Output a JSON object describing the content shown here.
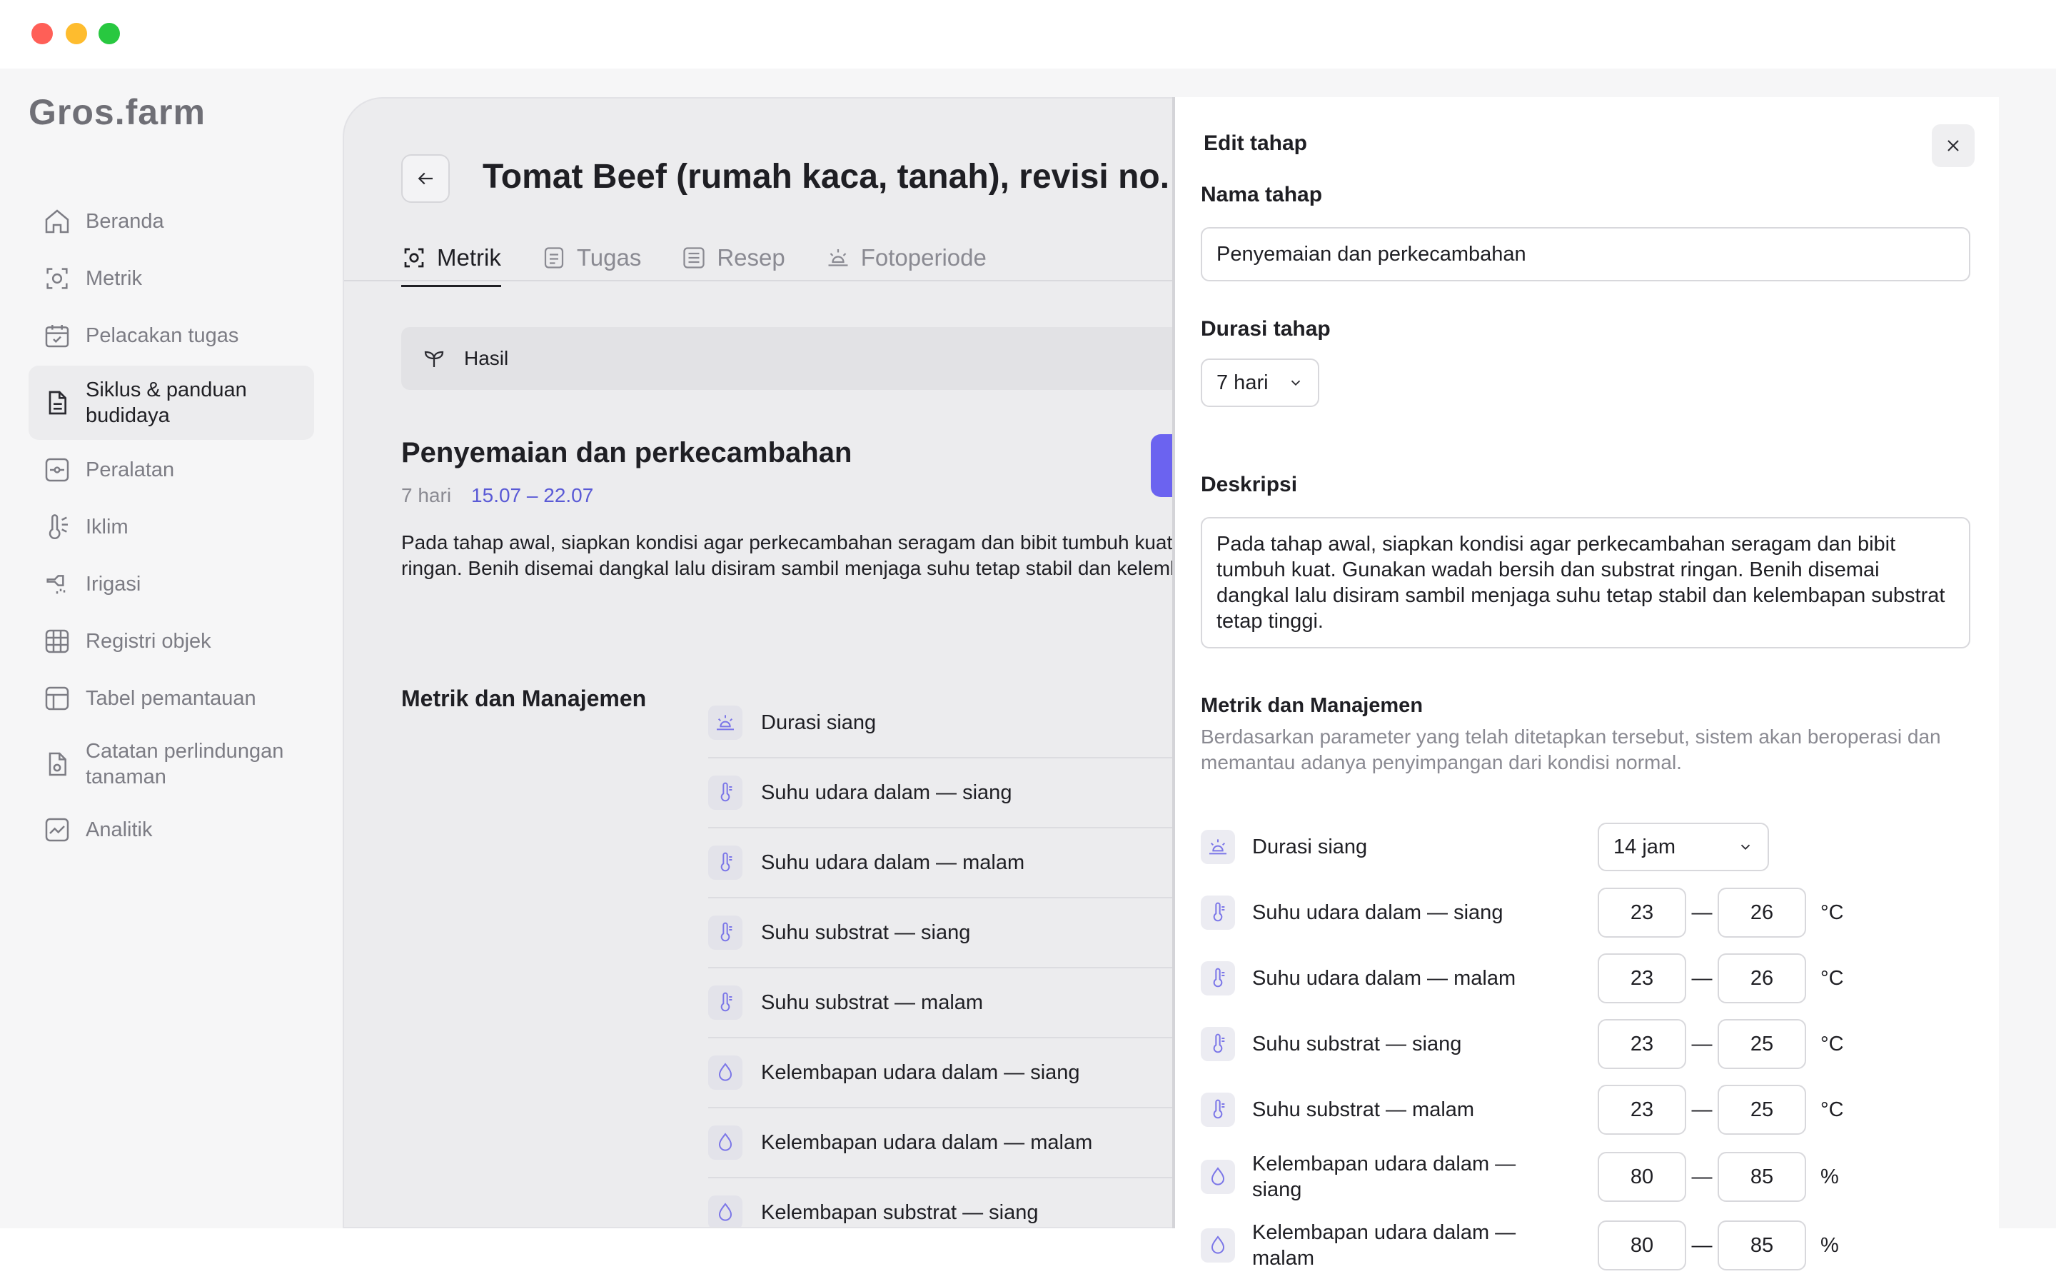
{
  "sidebar": {
    "logo": "Gros.farm",
    "items": [
      {
        "label": "Beranda",
        "icon": "home-icon"
      },
      {
        "label": "Metrik",
        "icon": "metric-icon"
      },
      {
        "label": "Pelacakan tugas",
        "icon": "calendar-check-icon"
      },
      {
        "label": "Siklus & panduan budidaya",
        "icon": "document-icon",
        "active": true
      },
      {
        "label": "Peralatan",
        "icon": "equipment-icon"
      },
      {
        "label": "Iklim",
        "icon": "climate-icon"
      },
      {
        "label": "Irigasi",
        "icon": "irrigation-icon"
      },
      {
        "label": "Registri objek",
        "icon": "grid-icon"
      },
      {
        "label": "Tabel pemantauan",
        "icon": "table-icon"
      },
      {
        "label": "Catatan perlindungan tanaman",
        "icon": "protection-note-icon"
      },
      {
        "label": "Analitik",
        "icon": "analytics-icon"
      }
    ]
  },
  "main": {
    "title": "Tomat Beef (rumah kaca, tanah), revisi no.",
    "tabs": [
      {
        "label": "Metrik",
        "active": true
      },
      {
        "label": "Tugas"
      },
      {
        "label": "Resep"
      },
      {
        "label": "Fotoperiode"
      }
    ],
    "result_label": "Hasil",
    "stage": {
      "title": "Penyemaian dan perkecambahan",
      "duration": "7 hari",
      "dates": "15.07 – 22.07",
      "description": "Pada tahap awal, siapkan kondisi agar perkecambahan seragam dan bibit tumbuh kuat. Gunakan wadah bersih dan substrat ringan. Benih disemai dangkal lalu disiram sambil menjaga suhu tetap stabil dan kelembapan substrat tetap tinggi."
    },
    "metrics_heading": "Metrik dan Manajemen",
    "metrics": [
      {
        "label": "Durasi siang",
        "icon": "sun-icon"
      },
      {
        "label": "Suhu udara dalam — siang",
        "icon": "thermometer-icon"
      },
      {
        "label": "Suhu udara dalam — malam",
        "icon": "thermometer-icon"
      },
      {
        "label": "Suhu substrat — siang",
        "icon": "thermometer-icon"
      },
      {
        "label": "Suhu substrat — malam",
        "icon": "thermometer-icon"
      },
      {
        "label": "Kelembapan udara dalam — siang",
        "icon": "droplet-icon"
      },
      {
        "label": "Kelembapan udara dalam — malam",
        "icon": "droplet-icon"
      },
      {
        "label": "Kelembapan substrat — siang",
        "icon": "droplet-icon"
      }
    ]
  },
  "panel": {
    "title": "Edit tahap",
    "name_label": "Nama tahap",
    "name_value": "Penyemaian dan perkecambahan",
    "duration_label": "Durasi tahap",
    "duration_value": "7 hari",
    "desc_label": "Deskripsi",
    "desc_value": "Pada tahap awal, siapkan kondisi agar perkecambahan seragam dan bibit tumbuh kuat. Gunakan wadah bersih dan substrat ringan. Benih disemai dangkal lalu disiram sambil menjaga suhu tetap stabil dan kelembapan substrat tetap tinggi.",
    "metrics_heading": "Metrik dan Manajemen",
    "metrics_subtext": "Berdasarkan parameter yang telah ditetapkan tersebut, sistem akan beroperasi dan memantau adanya penyimpangan dari kondisi normal.",
    "daylight": {
      "label": "Durasi siang",
      "value": "14 jam"
    },
    "params": [
      {
        "label": "Suhu udara dalam — siang",
        "min": "23",
        "max": "26",
        "unit": "°C",
        "icon": "thermometer-icon"
      },
      {
        "label": "Suhu udara dalam — malam",
        "min": "23",
        "max": "26",
        "unit": "°C",
        "icon": "thermometer-icon"
      },
      {
        "label": "Suhu substrat — siang",
        "min": "23",
        "max": "25",
        "unit": "°C",
        "icon": "thermometer-icon"
      },
      {
        "label": "Suhu substrat — malam",
        "min": "23",
        "max": "25",
        "unit": "°C",
        "icon": "thermometer-icon"
      },
      {
        "label": "Kelembapan udara dalam — siang",
        "min": "80",
        "max": "85",
        "unit": "%",
        "icon": "droplet-icon"
      },
      {
        "label": "Kelembapan udara dalam — malam",
        "min": "80",
        "max": "85",
        "unit": "%",
        "icon": "droplet-icon"
      }
    ],
    "dash": "—"
  },
  "colors": {
    "accent": "#6b63f0",
    "date_text": "#5a5ad6",
    "icon_tint": "#7b76e8"
  }
}
